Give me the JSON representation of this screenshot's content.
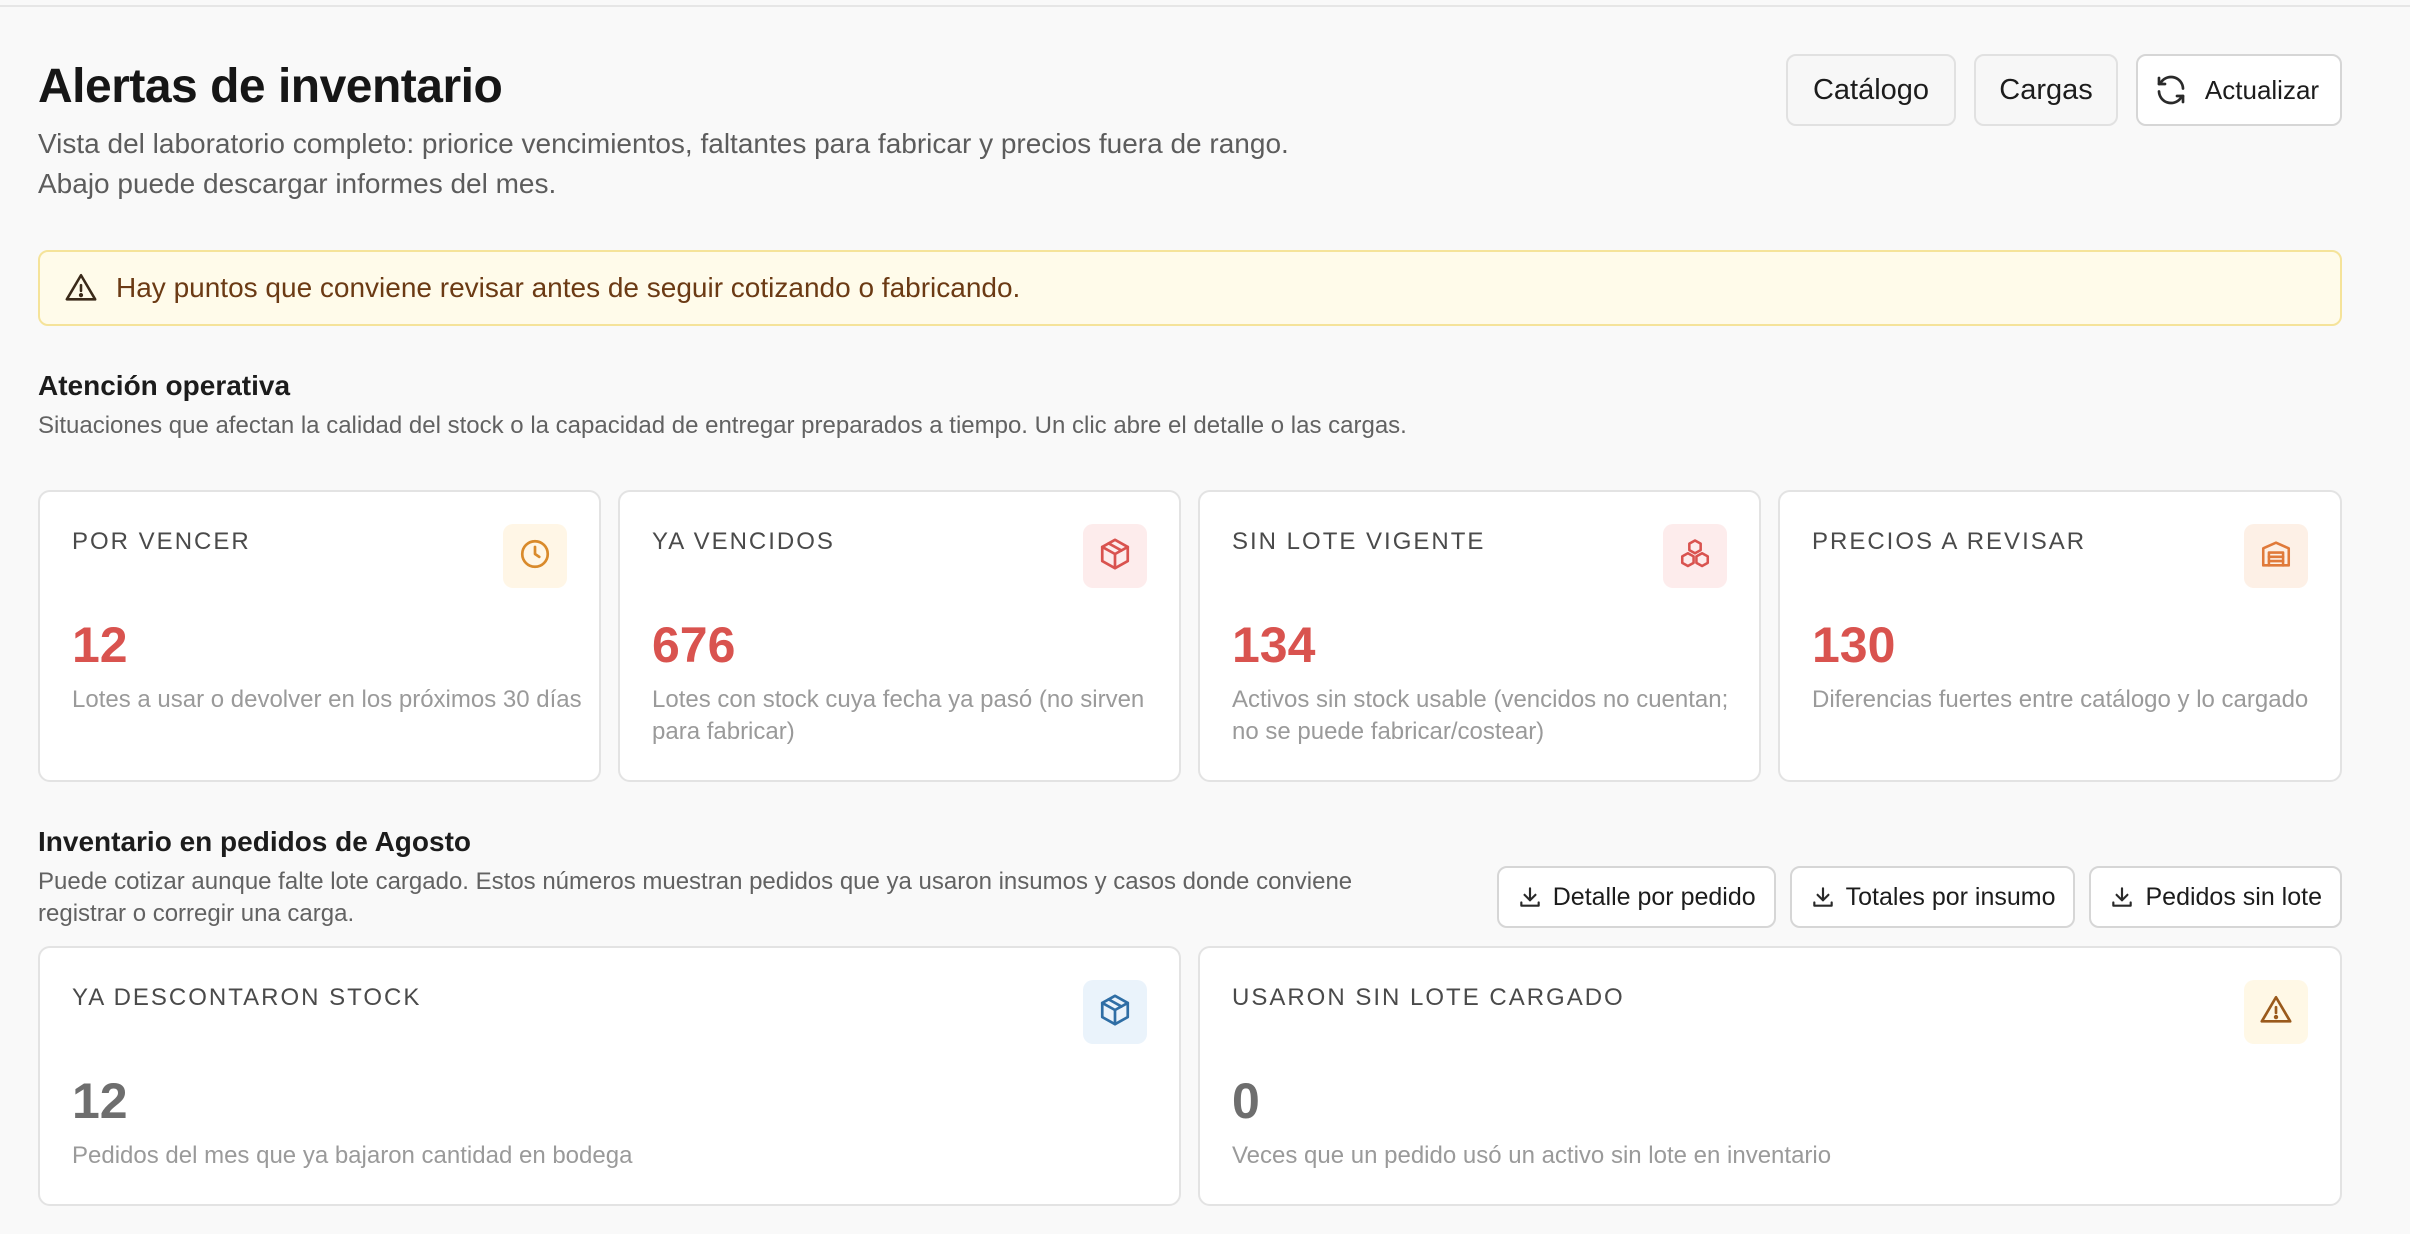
{
  "header": {
    "title": "Alertas de inventario",
    "subtitle_line1": "Vista del laboratorio completo: priorice vencimientos, faltantes para fabricar y precios fuera de rango.",
    "subtitle_line2": "Abajo puede descargar informes del mes.",
    "actions": {
      "catalog": "Catálogo",
      "loads": "Cargas",
      "refresh": "Actualizar"
    }
  },
  "alert": {
    "text": "Hay puntos que conviene revisar antes de seguir cotizando o fabricando.",
    "icon": "warning-icon"
  },
  "operational": {
    "title": "Atención operativa",
    "description": "Situaciones que afectan la calidad del stock o la capacidad de entregar preparados a tiempo. Un clic abre el detalle o las cargas.",
    "cards": [
      {
        "label": "POR VENCER",
        "value": "12",
        "desc": "Lotes a usar o devolver en los próximos 30 días",
        "icon": "clock-icon",
        "icon_color": "#d98a2b",
        "badge_bg": "#fff6e6"
      },
      {
        "label": "YA VENCIDOS",
        "value": "676",
        "desc": "Lotes con stock cuya fecha ya pasó (no sirven para fabricar)",
        "icon": "package-icon",
        "icon_color": "#d9534f",
        "badge_bg": "#fdecec"
      },
      {
        "label": "SIN LOTE VIGENTE",
        "value": "134",
        "desc": "Activos sin stock usable (vencidos no cuentan; no se puede fabricar/costear)",
        "icon": "boxes-icon",
        "icon_color": "#d9534f",
        "badge_bg": "#fdecec"
      },
      {
        "label": "PRECIOS A REVISAR",
        "value": "130",
        "desc": "Diferencias fuertes entre catálogo y lo cargado",
        "icon": "warehouse-icon",
        "icon_color": "#e07a3a",
        "badge_bg": "#fdf0e6"
      }
    ]
  },
  "orders": {
    "title": "Inventario en pedidos de Agosto",
    "description": "Puede cotizar aunque falte lote cargado. Estos números muestran pedidos que ya usaron insumos y casos donde conviene registrar o corregir una carga.",
    "downloads": {
      "by_order": "Detalle por pedido",
      "by_supply": "Totales por insumo",
      "without_lot": "Pedidos sin lote"
    },
    "cards": [
      {
        "label": "YA DESCONTARON STOCK",
        "value": "12",
        "desc": "Pedidos del mes que ya bajaron cantidad en bodega",
        "icon": "package-icon",
        "icon_color": "#2f6ea5",
        "badge_bg": "#eaf3fb"
      },
      {
        "label": "USARON SIN LOTE CARGADO",
        "value": "0",
        "desc": "Veces que un pedido usó un activo sin lote en inventario",
        "icon": "warning-icon",
        "icon_color": "#9a5a1c",
        "badge_bg": "#fff8e6"
      }
    ]
  }
}
